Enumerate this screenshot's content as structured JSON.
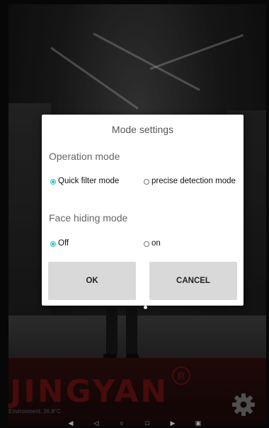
{
  "dialog": {
    "title": "Mode settings",
    "operation_mode": {
      "heading": "Operation mode",
      "options": [
        {
          "label": "Quick filter mode",
          "selected": true
        },
        {
          "label": "precise detection mode",
          "selected": false
        }
      ]
    },
    "face_hiding_mode": {
      "heading": "Face hiding mode",
      "options": [
        {
          "label": "Off",
          "selected": true
        },
        {
          "label": "on",
          "selected": false
        }
      ]
    },
    "buttons": {
      "ok": "OK",
      "cancel": "CANCEL"
    }
  },
  "brand": {
    "name": "JINGYAN",
    "registered_mark": "R",
    "color": "#5e0f0f"
  },
  "status": {
    "environment": "Environment: 26.8°C"
  },
  "settings": {
    "icon": "gear-icon"
  },
  "navigation_bar": {
    "icons": [
      "volume-down-icon",
      "back-icon",
      "home-icon",
      "recents-icon",
      "volume-up-icon",
      "screenshot-icon"
    ]
  },
  "colors": {
    "accent": "#28c4b8",
    "button_bg": "#d9d9d9"
  }
}
